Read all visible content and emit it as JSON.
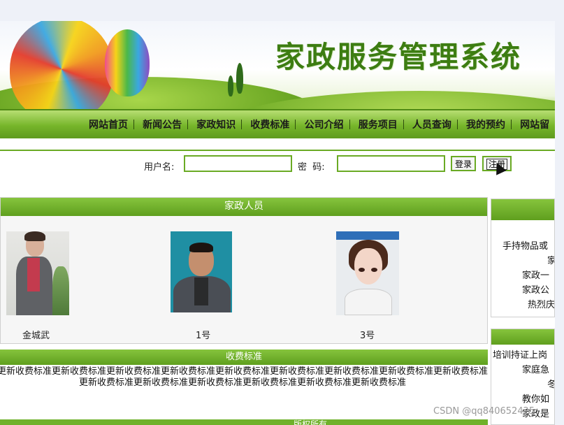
{
  "site": {
    "title": "家政服务管理系统"
  },
  "nav": {
    "items": [
      "网站首页",
      "新闻公告",
      "家政知识",
      "收费标准",
      "公司介绍",
      "服务项目",
      "人员查询",
      "我的预约",
      "网站留"
    ]
  },
  "login": {
    "username_label": "用户名:",
    "username_value": "",
    "password_label": "密  码:",
    "password_value": "",
    "login_button": "登录",
    "register_button": "注册"
  },
  "staff": {
    "header": "家政人员",
    "people": [
      {
        "name": "金城武"
      },
      {
        "name": "1号"
      },
      {
        "name": "3号"
      }
    ]
  },
  "fees": {
    "header": "收费标准",
    "body": "更新收费标准更新收费标准更新收费标准更新收费标准更新收费标准更新收费标准更新收费标准更新收费标准更新收费标准更新收费标准更新收费标准更新收费标准更新收费标准更新收费标准更新收费标准"
  },
  "bottom": {
    "label": "版权所有"
  },
  "right1": {
    "items": [
      "手持物品或",
      "家",
      "家政一",
      "家政公",
      "热烈庆"
    ]
  },
  "right2": {
    "items": [
      "培训持证上岗",
      "家庭急",
      "冬",
      "教你如",
      "家政是"
    ]
  },
  "watermark": "CSDN @qq840652425"
}
